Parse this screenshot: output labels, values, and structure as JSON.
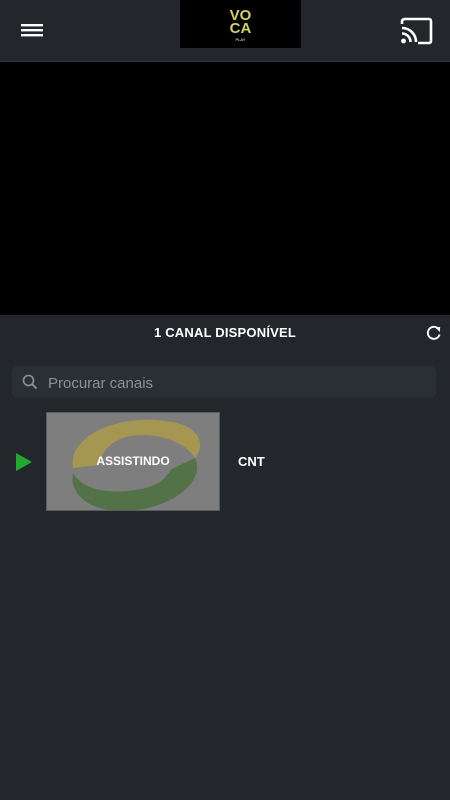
{
  "appbar": {
    "logo_text_top": "VO",
    "logo_text_bottom": "CA",
    "logo_sub": "PLAY",
    "menu_icon": "hamburger-menu-icon",
    "cast_icon": "cast-icon"
  },
  "channels_header": {
    "title": "1 CANAL DISPONÍVEL",
    "refresh_icon": "refresh-icon"
  },
  "search": {
    "placeholder": "Procurar canais",
    "value": ""
  },
  "channels": [
    {
      "name": "CNT",
      "status_label": "ASSISTINDO",
      "playing_icon": "play-icon"
    }
  ],
  "colors": {
    "background": "#23272b",
    "player": "#000000",
    "accent_green": "#1faa2e",
    "logo_yellow": "#d4d15a",
    "cnt_yellow": "#b8a23a",
    "cnt_green": "#3d6b2a"
  }
}
